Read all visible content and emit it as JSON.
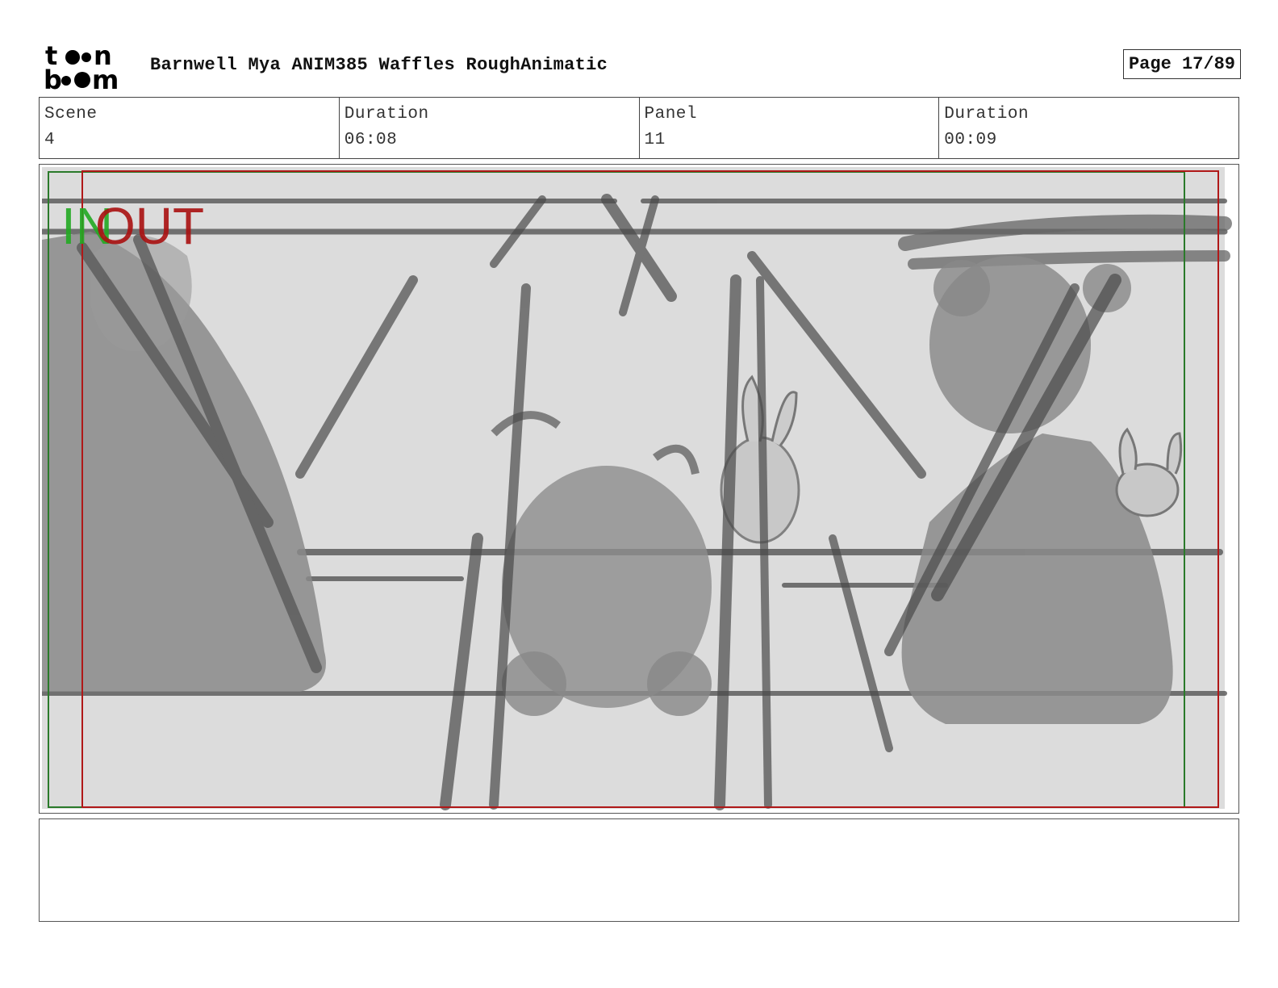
{
  "header": {
    "logo_text": "toon boom",
    "title": "Barnwell Mya ANIM385 Waffles RoughAnimatic",
    "page": "Page 17/89"
  },
  "info": {
    "scene_label": "Scene",
    "scene_value": "4",
    "scene_duration_label": "Duration",
    "scene_duration_value": "06:08",
    "panel_label": "Panel",
    "panel_value": "11",
    "panel_duration_label": "Duration",
    "panel_duration_value": "00:09"
  },
  "panel": {
    "in_marker": "IN",
    "out_marker": "OUT",
    "in_color": "#22aa22",
    "out_color": "#aa1111"
  },
  "notes": {
    "text": ""
  },
  "colors": {
    "frame_green": "#2a7a2a",
    "frame_red": "#b01818",
    "sketch_bg": "#dcdcdc"
  }
}
